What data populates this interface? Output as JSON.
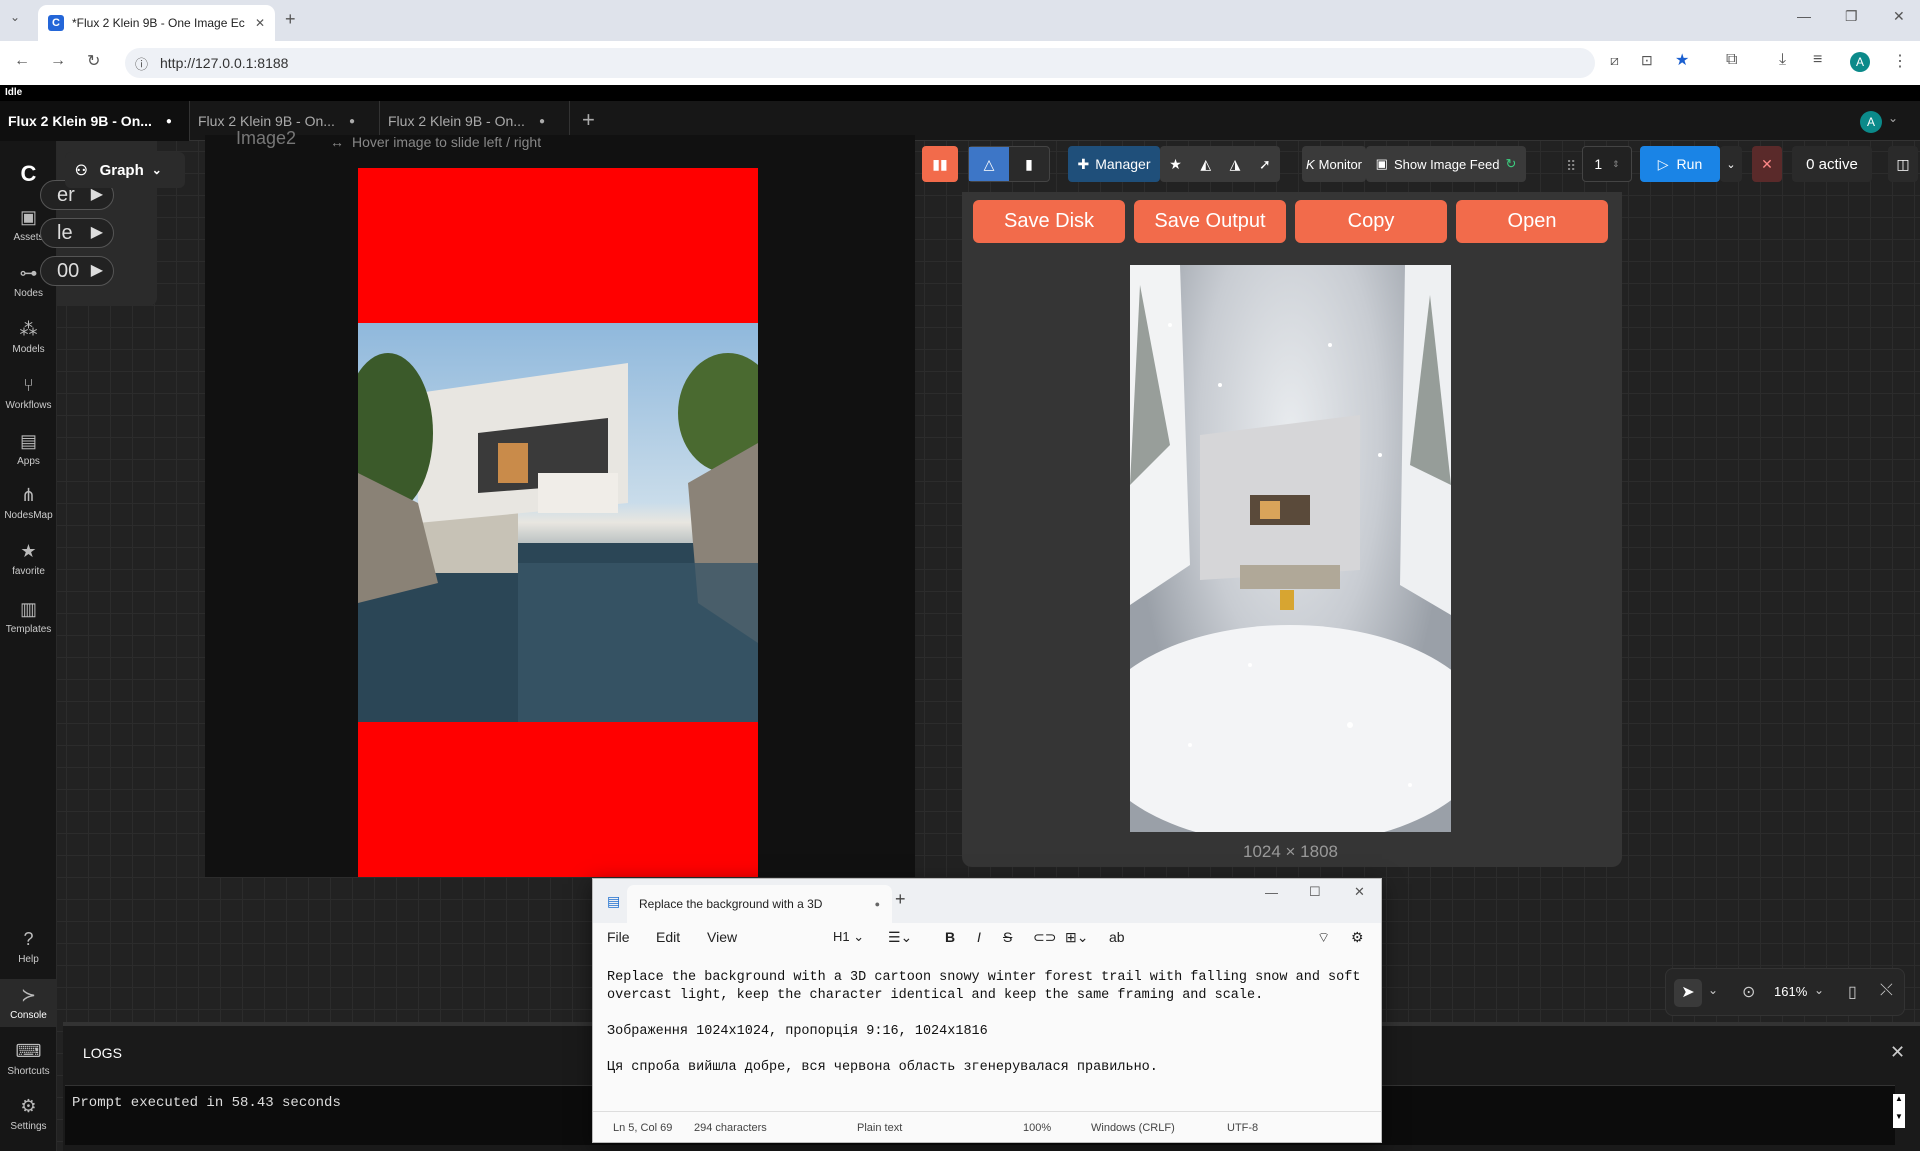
{
  "browser": {
    "tab_title": "*Flux 2 Klein 9B - One Image Ec",
    "url": "http://127.0.0.1:8188",
    "profile_initial": "A"
  },
  "app": {
    "status": "Idle",
    "workflow_tabs": [
      {
        "label": "Flux 2 Klein 9B - On...",
        "active": true
      },
      {
        "label": "Flux 2 Klein 9B - On...",
        "active": false
      },
      {
        "label": "Flux 2 Klein 9B - On...",
        "active": false
      }
    ],
    "profile_initial": "A",
    "sidebar": [
      {
        "label": "Assets",
        "icon": "image-icon"
      },
      {
        "label": "Nodes",
        "icon": "node-icon"
      },
      {
        "label": "Models",
        "icon": "models-icon"
      },
      {
        "label": "Workflows",
        "icon": "workflow-icon"
      },
      {
        "label": "Apps",
        "icon": "apps-icon"
      },
      {
        "label": "NodesMap",
        "icon": "nodesmap-icon"
      },
      {
        "label": "favorite",
        "icon": "star-icon"
      },
      {
        "label": "Templates",
        "icon": "templates-icon"
      },
      {
        "label": "Help",
        "icon": "help-icon"
      },
      {
        "label": "Console",
        "icon": "console-icon"
      },
      {
        "label": "Shortcuts",
        "icon": "keyboard-icon"
      },
      {
        "label": "Settings",
        "icon": "gear-icon"
      }
    ],
    "graph_button": "Graph",
    "left_pills": [
      "er",
      "le",
      "00"
    ],
    "node_title_fragment": "Image2",
    "hover_hint": "Hover image to slide left / right",
    "actionbar": {
      "manager": "Manager",
      "monitor": "Monitor",
      "show_image_feed": "Show Image Feed",
      "queue_count": "1",
      "run": "Run",
      "active": "0 active"
    },
    "feed_buttons": [
      "Save Disk",
      "Save Output",
      "Copy",
      "Open"
    ],
    "image_dims": "1024 × 1808",
    "logs_title": "LOGS",
    "log_line": "Prompt executed in 58.43 seconds",
    "canvas_zoom": "161%"
  },
  "notepad": {
    "tab_title": "Replace the background with a 3D",
    "menu": [
      "File",
      "Edit",
      "View"
    ],
    "heading_select": "H1",
    "lines": [
      "Replace the background with a 3D cartoon snowy winter forest trail with falling snow and soft",
      "overcast light, keep the character identical and keep the same framing and scale.",
      "",
      "Зображення 1024x1024, пропорція 9:16, 1024x1816",
      "",
      "Ця спроба вийшла добре, вся червона область згенерувалася правильно."
    ],
    "status": {
      "position": "Ln 5, Col 69",
      "chars": "294 characters",
      "format": "Plain text",
      "zoom": "100%",
      "eol": "Windows (CRLF)",
      "encoding": "UTF-8"
    }
  }
}
